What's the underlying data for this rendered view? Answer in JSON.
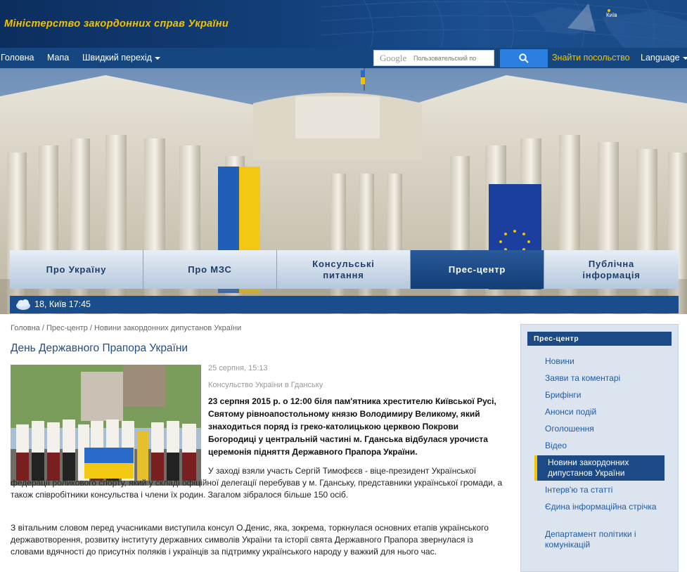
{
  "header": {
    "site_title": "Міністерство закордонних справ України",
    "map_label": "Київ"
  },
  "topnav": {
    "home": "Головна",
    "map": "Мапа",
    "quick_nav": "Швидкий перехід",
    "search_brand": "Google",
    "search_placeholder": "Пользовательский по",
    "find_embassy": "Знайти посольство",
    "language": "Language"
  },
  "tabs": [
    {
      "label": "Про Україну",
      "active": false
    },
    {
      "label": "Про МЗС",
      "active": false
    },
    {
      "label": "Консульські питання",
      "active": false
    },
    {
      "label": "Прес-центр",
      "active": true
    },
    {
      "label": "Публічна інформація",
      "active": false
    }
  ],
  "weather": {
    "text": "18, Київ 17:45",
    "icon": "cloud-icon"
  },
  "breadcrumb": {
    "home": "Головна",
    "sep": " / ",
    "press": "Прес-центр",
    "current": "Новини закордонних дипустанов України"
  },
  "article": {
    "title": "День Державного Прапора України",
    "date": "25 серпня, 15:13",
    "source": "Консульство України в Гданську",
    "lead": "23 серпня 2015 р. о 12:00 біля пам'ятника хрестителю Київської Русі, Святому рівноапостольному князю Володимиру Великому, який знаходиться поряд із греко-католицькою церквою Покрови Богородиці у центральній частині м. Гданська відбулася урочиста церемонія підняття Державного Прапора України.",
    "para1": "У заході взяли участь  Сергій Тимофєєв - віце-президент Української федерації роликового спорту, який у складі офіційної делегації перебував у м. Гданську, представники української громади, а також співробітники консульства і члени їх родин. Загалом зібралося більше 150 осіб.",
    "para2": "З вітальним словом перед учасниками виступила   консул О.Денис, яка, зокрема, торкнулася основних етапів українського державотворення, розвитку інституту державних символів України та історії свята Державного Прапора звернулася із словами вдячності до присутніх поляків і українців за підтримку українського народу у важкий для нього час."
  },
  "sidebar": {
    "heading": "Прес-центр",
    "items": [
      {
        "label": "Новини",
        "active": false
      },
      {
        "label": "Заяви та коментарі",
        "active": false
      },
      {
        "label": "Брифінги",
        "active": false
      },
      {
        "label": "Анонси подій",
        "active": false
      },
      {
        "label": "Оголошення",
        "active": false
      },
      {
        "label": "Відео",
        "active": false
      },
      {
        "label": "Новини закордонних дипустанов України",
        "active": true
      },
      {
        "label": "Інтерв'ю та статті",
        "active": false
      },
      {
        "label": "Єдина інформаційна стрічка",
        "active": false
      },
      {
        "label": "Департамент політики і комунікацій",
        "active": false
      }
    ]
  },
  "colors": {
    "header_bg": "#123e78",
    "title_gold": "#f2c200",
    "nav_bg": "#16467f",
    "search_btn": "#2a7fe0",
    "link_blue": "#1e5ba8",
    "active_blue": "#1b4a87"
  }
}
